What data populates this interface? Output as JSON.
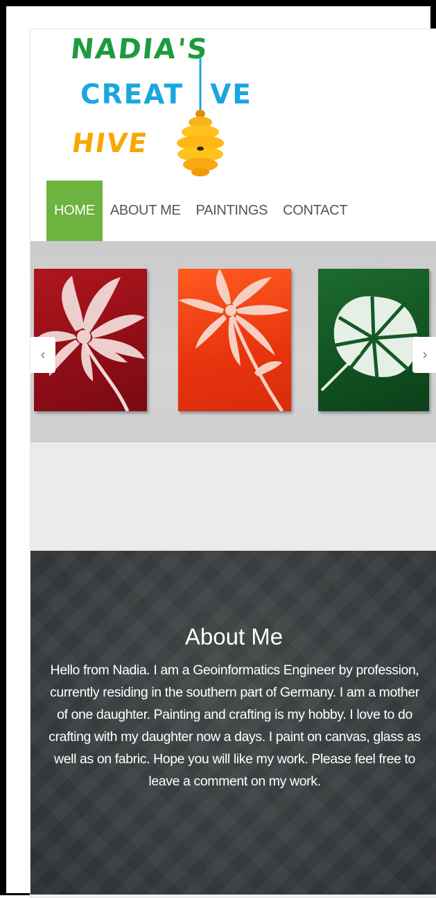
{
  "logo": {
    "line1": "NADIA'S",
    "line2a": "CREAT",
    "line2b": "VE",
    "line3": "HIVE",
    "colors": {
      "green": "#1e9b3d",
      "blue": "#1aa7e0",
      "orange": "#f6a800"
    },
    "hive_icon": "beehive-icon"
  },
  "nav": {
    "items": [
      {
        "label": "HOME",
        "active": true
      },
      {
        "label": "ABOUT ME",
        "active": false
      },
      {
        "label": "PAINTINGS",
        "active": false
      },
      {
        "label": "CONTACT",
        "active": false
      }
    ],
    "active_color": "#6db33f"
  },
  "slider": {
    "prev_icon": "‹",
    "next_icon": "›",
    "paintings": [
      "red-flower-painting",
      "orange-flower-painting",
      "green-leaf-painting"
    ]
  },
  "about": {
    "title": "About Me",
    "text": "Hello from Nadia. I am a Geoinformatics Engineer by profession, currently residing in the southern part of Germany. I am a mother of one daughter. Painting and crafting is my hobby. I love to do crafting with my daughter now a days. I paint on canvas, glass as well as on fabric. Hope you will like my work. Please feel free to leave a comment on my work."
  }
}
